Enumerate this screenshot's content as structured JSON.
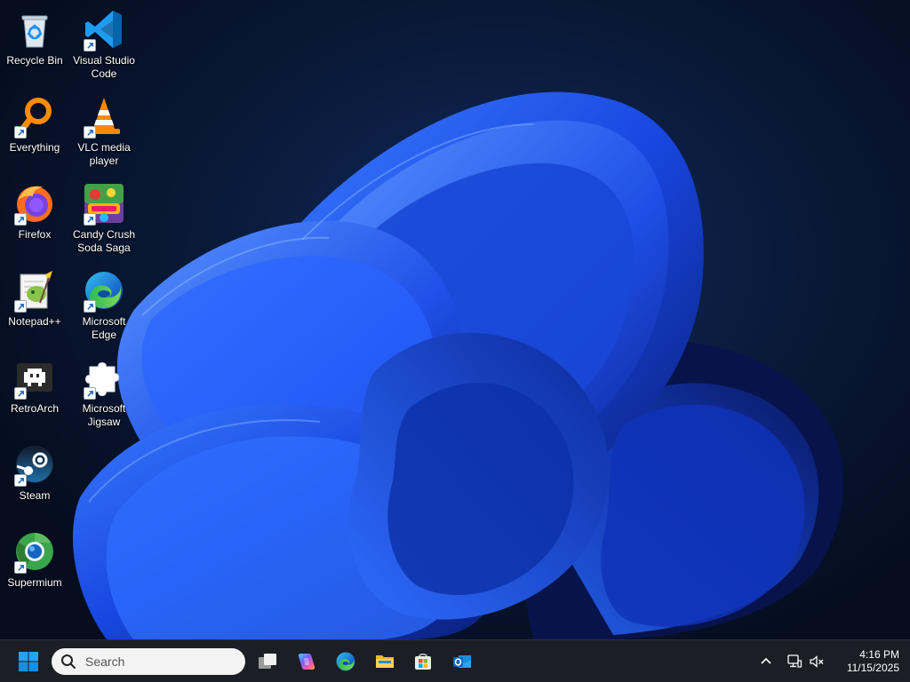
{
  "desktop": {
    "icons": [
      {
        "label": "Recycle Bin",
        "icon": "recycle-bin-icon",
        "shortcut": false
      },
      {
        "label": "Visual Studio Code",
        "icon": "vscode-icon",
        "shortcut": true
      },
      {
        "label": "Everything",
        "icon": "everything-search-icon",
        "shortcut": true
      },
      {
        "label": "VLC media player",
        "icon": "vlc-icon",
        "shortcut": true
      },
      {
        "label": "Firefox",
        "icon": "firefox-icon",
        "shortcut": true
      },
      {
        "label": "Candy Crush Soda Saga",
        "icon": "candy-crush-icon",
        "shortcut": true
      },
      {
        "label": "Notepad++",
        "icon": "notepad-plus-plus-icon",
        "shortcut": true
      },
      {
        "label": "Microsoft Edge",
        "icon": "edge-icon",
        "shortcut": true
      },
      {
        "label": "RetroArch",
        "icon": "retroarch-icon",
        "shortcut": true
      },
      {
        "label": "Microsoft Jigsaw",
        "icon": "jigsaw-puzzle-icon",
        "shortcut": true
      },
      {
        "label": "Steam",
        "icon": "steam-icon",
        "shortcut": true
      },
      {
        "label": "Supermium",
        "icon": "supermium-icon",
        "shortcut": true
      }
    ]
  },
  "taskbar": {
    "start_icon": "windows-start-icon",
    "search_placeholder": "Search",
    "pinned": [
      {
        "name": "Task View",
        "icon": "task-view-icon"
      },
      {
        "name": "Copilot",
        "icon": "copilot-icon"
      },
      {
        "name": "Microsoft Edge",
        "icon": "edge-icon"
      },
      {
        "name": "File Explorer",
        "icon": "file-explorer-icon"
      },
      {
        "name": "Microsoft Store",
        "icon": "microsoft-store-icon"
      },
      {
        "name": "Outlook",
        "icon": "outlook-icon"
      }
    ],
    "tray": {
      "chevron_icon": "chevron-up-icon",
      "network_icon": "network-icon",
      "volume_icon": "volume-muted-icon"
    },
    "clock": {
      "time": "4:16 PM",
      "date": "11/15/2025"
    }
  },
  "colors": {
    "taskbar_bg": "#1c1e26",
    "wallpaper_dark": "#050d1f",
    "bloom_blue": "#1f5cff",
    "accent": "#0078d4"
  }
}
